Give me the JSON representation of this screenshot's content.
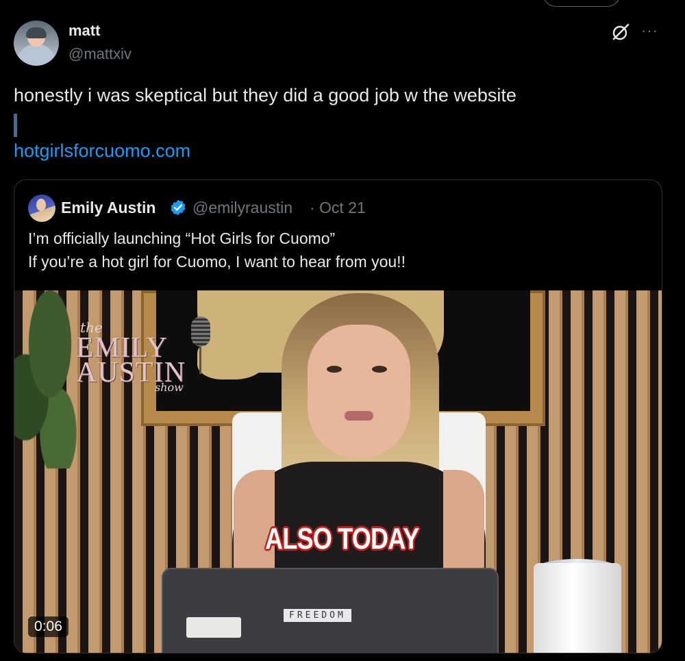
{
  "tweet": {
    "display_name": "matt",
    "handle": "@mattxiv",
    "text": "honestly i was skeptical but they did a good job w the website",
    "link": "hotgirlsforcuomo.com",
    "more_icon": "more-icon",
    "grok_icon": "grok-icon"
  },
  "quote": {
    "display_name": "Emily Austin",
    "verified": true,
    "handle": "@emilyraustin",
    "separator": "·",
    "time": "Oct 21",
    "line1": "I’m officially launching “Hot Girls for Cuomo”",
    "line2": "If you’re a hot girl for Cuomo, I want to hear from you!!"
  },
  "video": {
    "duration": "0:06",
    "caption": "ALSO TODAY",
    "logo_the": "the",
    "logo_line1": "EMILY",
    "logo_line2": "AUSTIN",
    "logo_show": "show",
    "sticker": "FREEDOM"
  },
  "colors": {
    "background": "#000000",
    "link": "#1d9bf0",
    "verified": "#1d9bf0",
    "muted": "#71767b",
    "caption_outline": "#c41d1d"
  }
}
